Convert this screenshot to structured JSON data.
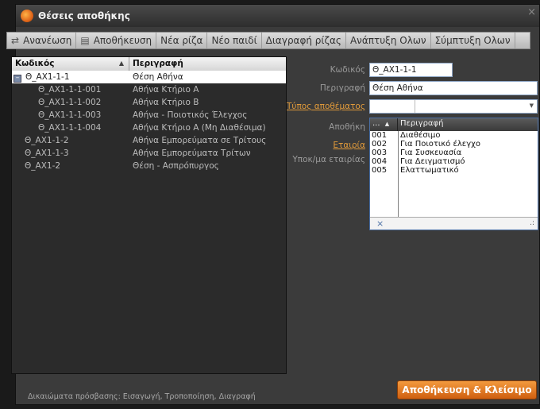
{
  "window": {
    "title": "Θέσεις αποθήκης",
    "close_glyph": "×"
  },
  "toolbar": [
    {
      "label": "Ανανέωση",
      "icon": "refresh-icon",
      "glyph": "⇄"
    },
    {
      "label": "Αποθήκευση",
      "icon": "save-icon",
      "glyph": "▤"
    },
    {
      "label": "Νέα ρίζα"
    },
    {
      "label": "Νέο παιδί"
    },
    {
      "label": "Διαγραφή ρίζας"
    },
    {
      "label": "Ανάπτυξη Ολων"
    },
    {
      "label": "Σύμπτυξη Ολων"
    }
  ],
  "tree": {
    "columns": {
      "code": "Κωδικός",
      "description": "Περιγραφή"
    },
    "sort_glyph": "▲",
    "expander_glyph": "–",
    "rows": [
      {
        "code": "Θ_ΑΧ1-1-1",
        "description": "Θέση Αθήνα",
        "level": 0,
        "selected": true,
        "expander": true
      },
      {
        "code": "Θ_ΑΧ1-1-1-001",
        "description": "Αθήνα Κτήριο Α",
        "level": 2
      },
      {
        "code": "Θ_ΑΧ1-1-1-002",
        "description": "Αθήνα Κτήριο Β",
        "level": 2
      },
      {
        "code": "Θ_ΑΧ1-1-1-003",
        "description": "Αθήνα - Ποιοτικός Έλεγχος",
        "level": 2
      },
      {
        "code": "Θ_ΑΧ1-1-1-004",
        "description": "Αθήνα Κτήριο Α (Μη Διαθέσιμα)",
        "level": 2
      },
      {
        "code": "Θ_ΑΧ1-1-2",
        "description": "Αθήνα Εμπορεύματα σε Τρίτους",
        "level": 1
      },
      {
        "code": "Θ_ΑΧ1-1-3",
        "description": "Αθήνα Εμπορεύματα Τρίτων",
        "level": 1
      },
      {
        "code": "Θ_ΑΧ1-2",
        "description": "Θέση - Ασπρόπυργος",
        "level": 1
      }
    ]
  },
  "form": {
    "code_label": "Κωδικός",
    "code_value": "Θ_ΑΧ1-1-1",
    "desc_label": "Περιγραφή",
    "desc_value": "Θέση Αθήνα",
    "type_label": "Τύπος αποθέματος",
    "type_value": "",
    "dropdown_glyph": "▼",
    "warehouse_label": "Αποθήκη",
    "company_label": "Εταιρία",
    "branch_label": "Υποκ/μα εταιρίας"
  },
  "dropdown": {
    "columns": {
      "code": "...",
      "description": "Περιγραφή"
    },
    "sort_glyph": "▲",
    "options": [
      {
        "code": "001",
        "description": "Διαθέσιμο"
      },
      {
        "code": "002",
        "description": "Για Ποιοτικό έλεγχο"
      },
      {
        "code": "003",
        "description": "Για Συσκευασία"
      },
      {
        "code": "004",
        "description": "Για Δειγματισμό"
      },
      {
        "code": "005",
        "description": "Ελαττωματικό"
      }
    ],
    "clear_glyph": "×",
    "grip_glyph": ".:"
  },
  "footer": {
    "rights_text": "Δικαιώματα πρόσβασης: Εισαγωγή, Τροποποίηση, Διαγραφή",
    "save_close_label": "Αποθήκευση & Κλείσιμο"
  },
  "colors": {
    "accent": "#e0661a",
    "link": "#e09a3b",
    "selection": "#ffffff",
    "field_border": "#8fa7c7"
  }
}
